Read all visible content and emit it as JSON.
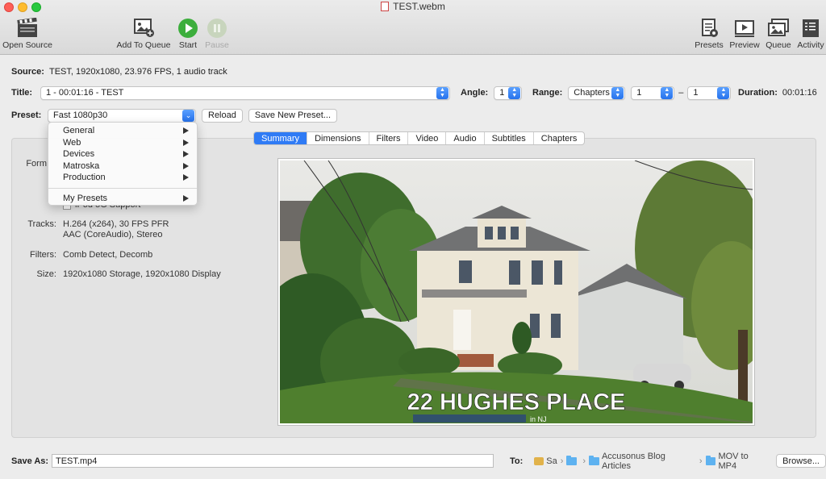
{
  "window": {
    "title": "TEST.webm"
  },
  "toolbar": {
    "open_source": "Open Source",
    "add_to_queue": "Add To Queue",
    "start": "Start",
    "pause": "Pause",
    "presets": "Presets",
    "preview": "Preview",
    "queue": "Queue",
    "activity": "Activity"
  },
  "source": {
    "label": "Source:",
    "value": "TEST, 1920x1080, 23.976 FPS, 1 audio track"
  },
  "title_row": {
    "label": "Title:",
    "value": "1 - 00:01:16 - TEST",
    "angle_label": "Angle:",
    "angle_value": "1",
    "range_label": "Range:",
    "range_type": "Chapters",
    "range_start": "1",
    "range_dash": "–",
    "range_end": "1",
    "duration_label": "Duration:",
    "duration_value": "00:01:16"
  },
  "preset": {
    "label": "Preset:",
    "value": "Fast 1080p30",
    "reload": "Reload",
    "save_new": "Save New Preset..."
  },
  "preset_menu": {
    "items": [
      "General",
      "Web",
      "Devices",
      "Matroska",
      "Production"
    ],
    "my_presets": "My Presets"
  },
  "tabs": [
    "Summary",
    "Dimensions",
    "Filters",
    "Video",
    "Audio",
    "Subtitles",
    "Chapters"
  ],
  "summary": {
    "format_label": "Form",
    "format_partial": "iPod 5G Support",
    "tracks_label": "Tracks:",
    "tracks_line1": "H.264 (x264), 30 FPS PFR",
    "tracks_line2": "AAC (CoreAudio), Stereo",
    "filters_label": "Filters:",
    "filters_value": "Comb Detect, Decomb",
    "size_label": "Size:",
    "size_value": "1920x1080 Storage, 1920x1080 Display"
  },
  "preview_image": {
    "caption": "22 HUGHES PLACE",
    "subcaption": "in NJ"
  },
  "save": {
    "label": "Save As:",
    "value": "TEST.mp4",
    "to_label": "To:",
    "path": [
      "Sa",
      "",
      "Accusonus Blog Articles",
      "MOV to MP4"
    ],
    "browse": "Browse..."
  }
}
